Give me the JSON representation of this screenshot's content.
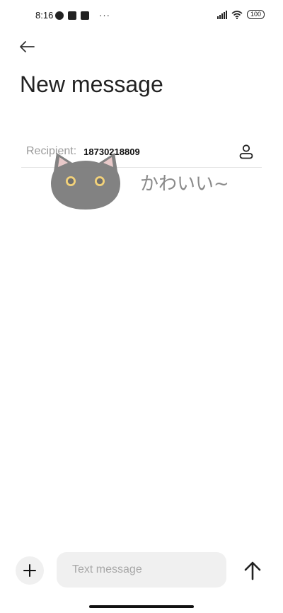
{
  "status_bar": {
    "time": "8:16",
    "overflow": "···",
    "battery": "100"
  },
  "header": {
    "title": "New message",
    "back_icon": "arrow-left-icon"
  },
  "recipient": {
    "label": "Recipient:",
    "value": "18730218809",
    "contact_icon": "person-icon"
  },
  "overlay": {
    "sticker_icon": "cat-face-icon",
    "sticker_text": "かわいい~"
  },
  "composer": {
    "add_icon": "plus-icon",
    "placeholder": "Text message",
    "value": "",
    "send_icon": "arrow-up-icon"
  }
}
